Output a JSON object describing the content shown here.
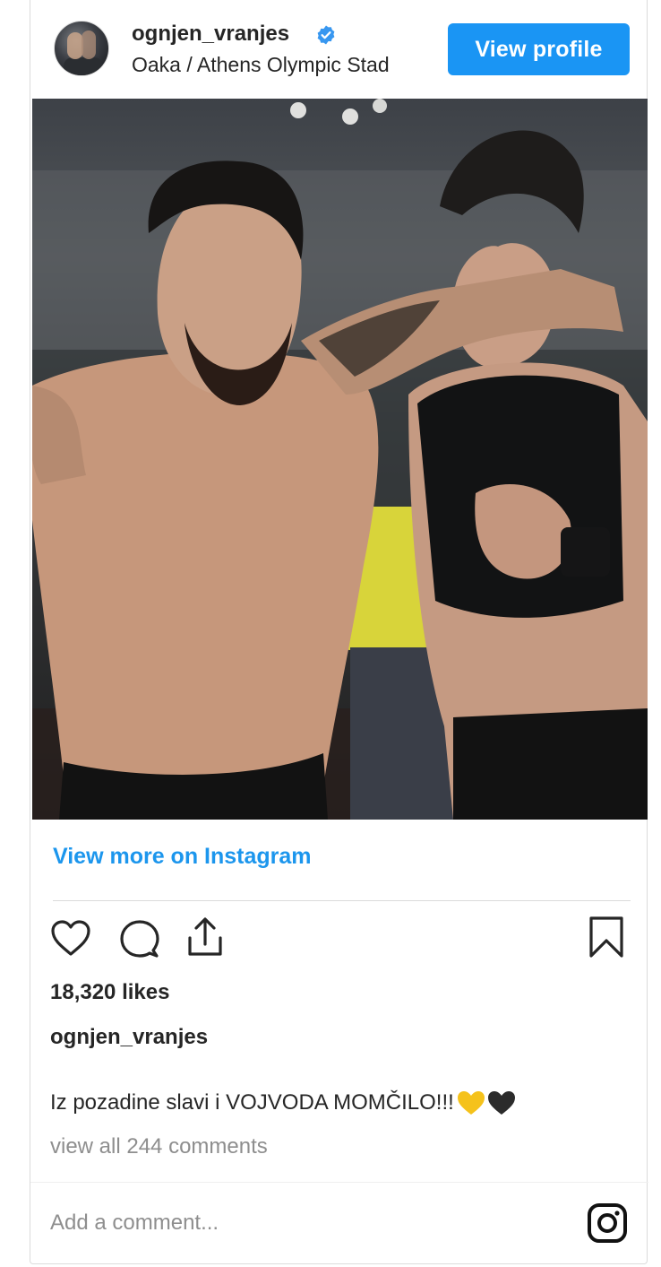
{
  "header": {
    "username": "ognjen_vranjes",
    "location": "Oaka / Athens Olympic Stad",
    "view_profile_label": "View profile"
  },
  "post": {
    "view_more_label": "View more on Instagram",
    "likes": "18,320 likes",
    "caption_user": "ognjen_vranjes",
    "caption_text": "Iz pozadine slavi i VOJVODA MOMČILO!!!",
    "caption_emoji": [
      "yellow-heart",
      "black-heart"
    ],
    "view_comments_label": "view all 244 comments"
  },
  "footer": {
    "add_comment_placeholder": "Add a comment..."
  },
  "icons": [
    "verified-badge-icon",
    "heart-icon",
    "comment-icon",
    "share-icon",
    "bookmark-icon",
    "instagram-icon"
  ],
  "colors": {
    "accent": "#1a95f4",
    "link": "#1c96ed",
    "text": "#262626",
    "muted": "#8e8e8e"
  }
}
